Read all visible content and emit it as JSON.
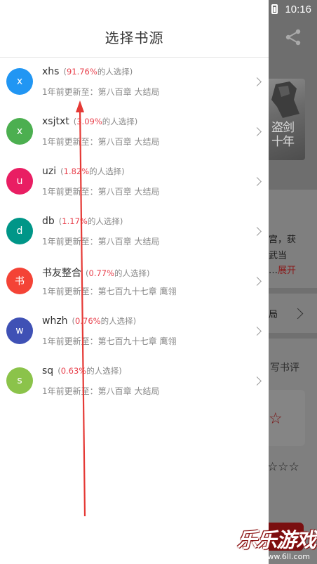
{
  "status_bar": {
    "time": "10:16"
  },
  "drawer": {
    "title": "选择书源",
    "sources": [
      {
        "avatar_letter": "x",
        "avatar_color": "#2196F3",
        "name": "xhs",
        "percent": "91.76%",
        "suffix": "的人选择)",
        "update_prefix": "1年前更新至：",
        "chapter": "第八百章 大结局"
      },
      {
        "avatar_letter": "x",
        "avatar_color": "#4CAF50",
        "name": "xsjtxt",
        "percent": "3.09%",
        "suffix": "的人选择)",
        "update_prefix": "1年前更新至：",
        "chapter": "第八百章 大结局"
      },
      {
        "avatar_letter": "u",
        "avatar_color": "#E91E63",
        "name": "uzi",
        "percent": "1.82%",
        "suffix": "的人选择)",
        "update_prefix": "1年前更新至：",
        "chapter": "第八百章 大结局"
      },
      {
        "avatar_letter": "d",
        "avatar_color": "#009688",
        "name": "db",
        "percent": "1.17%",
        "suffix": "的人选择)",
        "update_prefix": "1年前更新至：",
        "chapter": "第八百章 大结局"
      },
      {
        "avatar_letter": "书",
        "avatar_color": "#F44336",
        "name": "书友整合",
        "percent": "0.77%",
        "suffix": "的人选择)",
        "update_prefix": "1年前更新至：",
        "chapter": "第七百九十七章 鹰翎"
      },
      {
        "avatar_letter": "w",
        "avatar_color": "#3F51B5",
        "name": "whzh",
        "percent": "0.76%",
        "suffix": "的人选择)",
        "update_prefix": "1年前更新至：",
        "chapter": "第七百九十七章 鹰翎"
      },
      {
        "avatar_letter": "s",
        "avatar_color": "#8BC34A",
        "name": "sq",
        "percent": "0.63%",
        "suffix": "的人选择)",
        "update_prefix": "1年前更新至：",
        "chapter": "第八百章 大结局"
      }
    ]
  },
  "background": {
    "cover_text": "盗剑\n十年",
    "intro_lines": [
      "宫，获",
      "武当"
    ],
    "expand_prefix": "…",
    "expand_label": "展开",
    "latest_label": "局",
    "review_label": "写书评"
  },
  "watermark": {
    "main": "乐乐游戏",
    "url": "www.6ll.com"
  },
  "colors": {
    "accent_red": "#e8414d",
    "arrow_red": "#e53935"
  }
}
